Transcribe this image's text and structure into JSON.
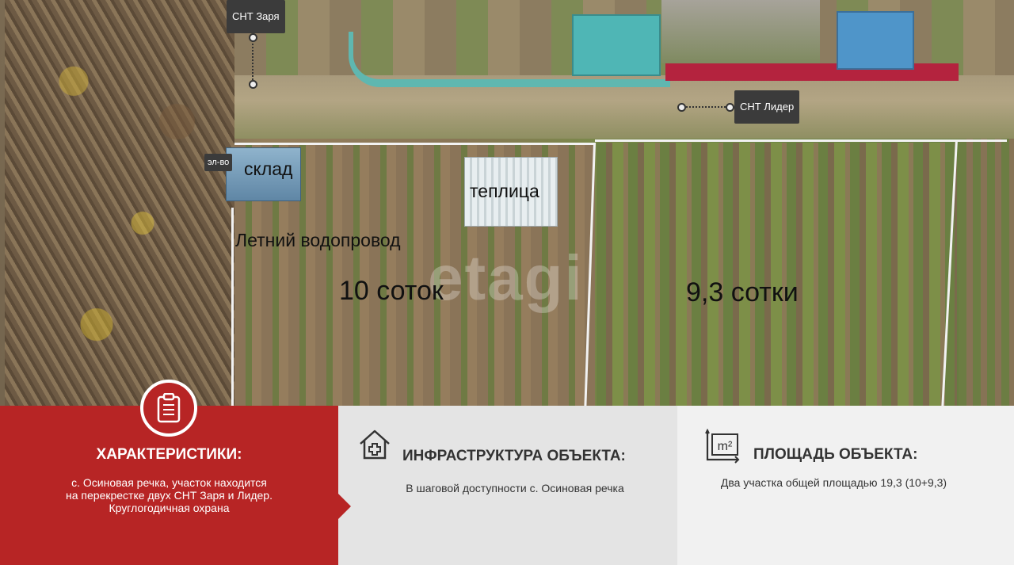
{
  "map": {
    "labels": {
      "sklad": "склад",
      "teplica": "теплица",
      "vodoprovod": "Летний водопровод",
      "plot_left": "10 соток",
      "plot_right": "9,3 сотки",
      "el_vo": "эл-во"
    },
    "tags": {
      "snt_zarya": "СНТ Заря",
      "snt_lider": "СНТ Лидер"
    },
    "watermark": "etagi"
  },
  "panels": {
    "characteristics": {
      "title": "ХАРАКТЕРИСТИКИ:",
      "lines": [
        "с. Осиновая речка, участок находится",
        "на перекрестке двух СНТ Заря и Лидер.",
        "Круглогодичная охрана"
      ]
    },
    "infrastructure": {
      "title": "ИНФРАСТРУКТУРА ОБЪЕКТА:",
      "text": "В шаговой доступности с. Осиновая речка"
    },
    "area": {
      "title": "ПЛОЩАДЬ ОБЪЕКТА:",
      "text": "Два участка общей площадью 19,3 (10+9,3)",
      "icon_text": "m²"
    }
  },
  "colors": {
    "red_panel": "#b72525",
    "mid_panel": "#e4e4e4",
    "right_panel": "#f1f1f1"
  }
}
